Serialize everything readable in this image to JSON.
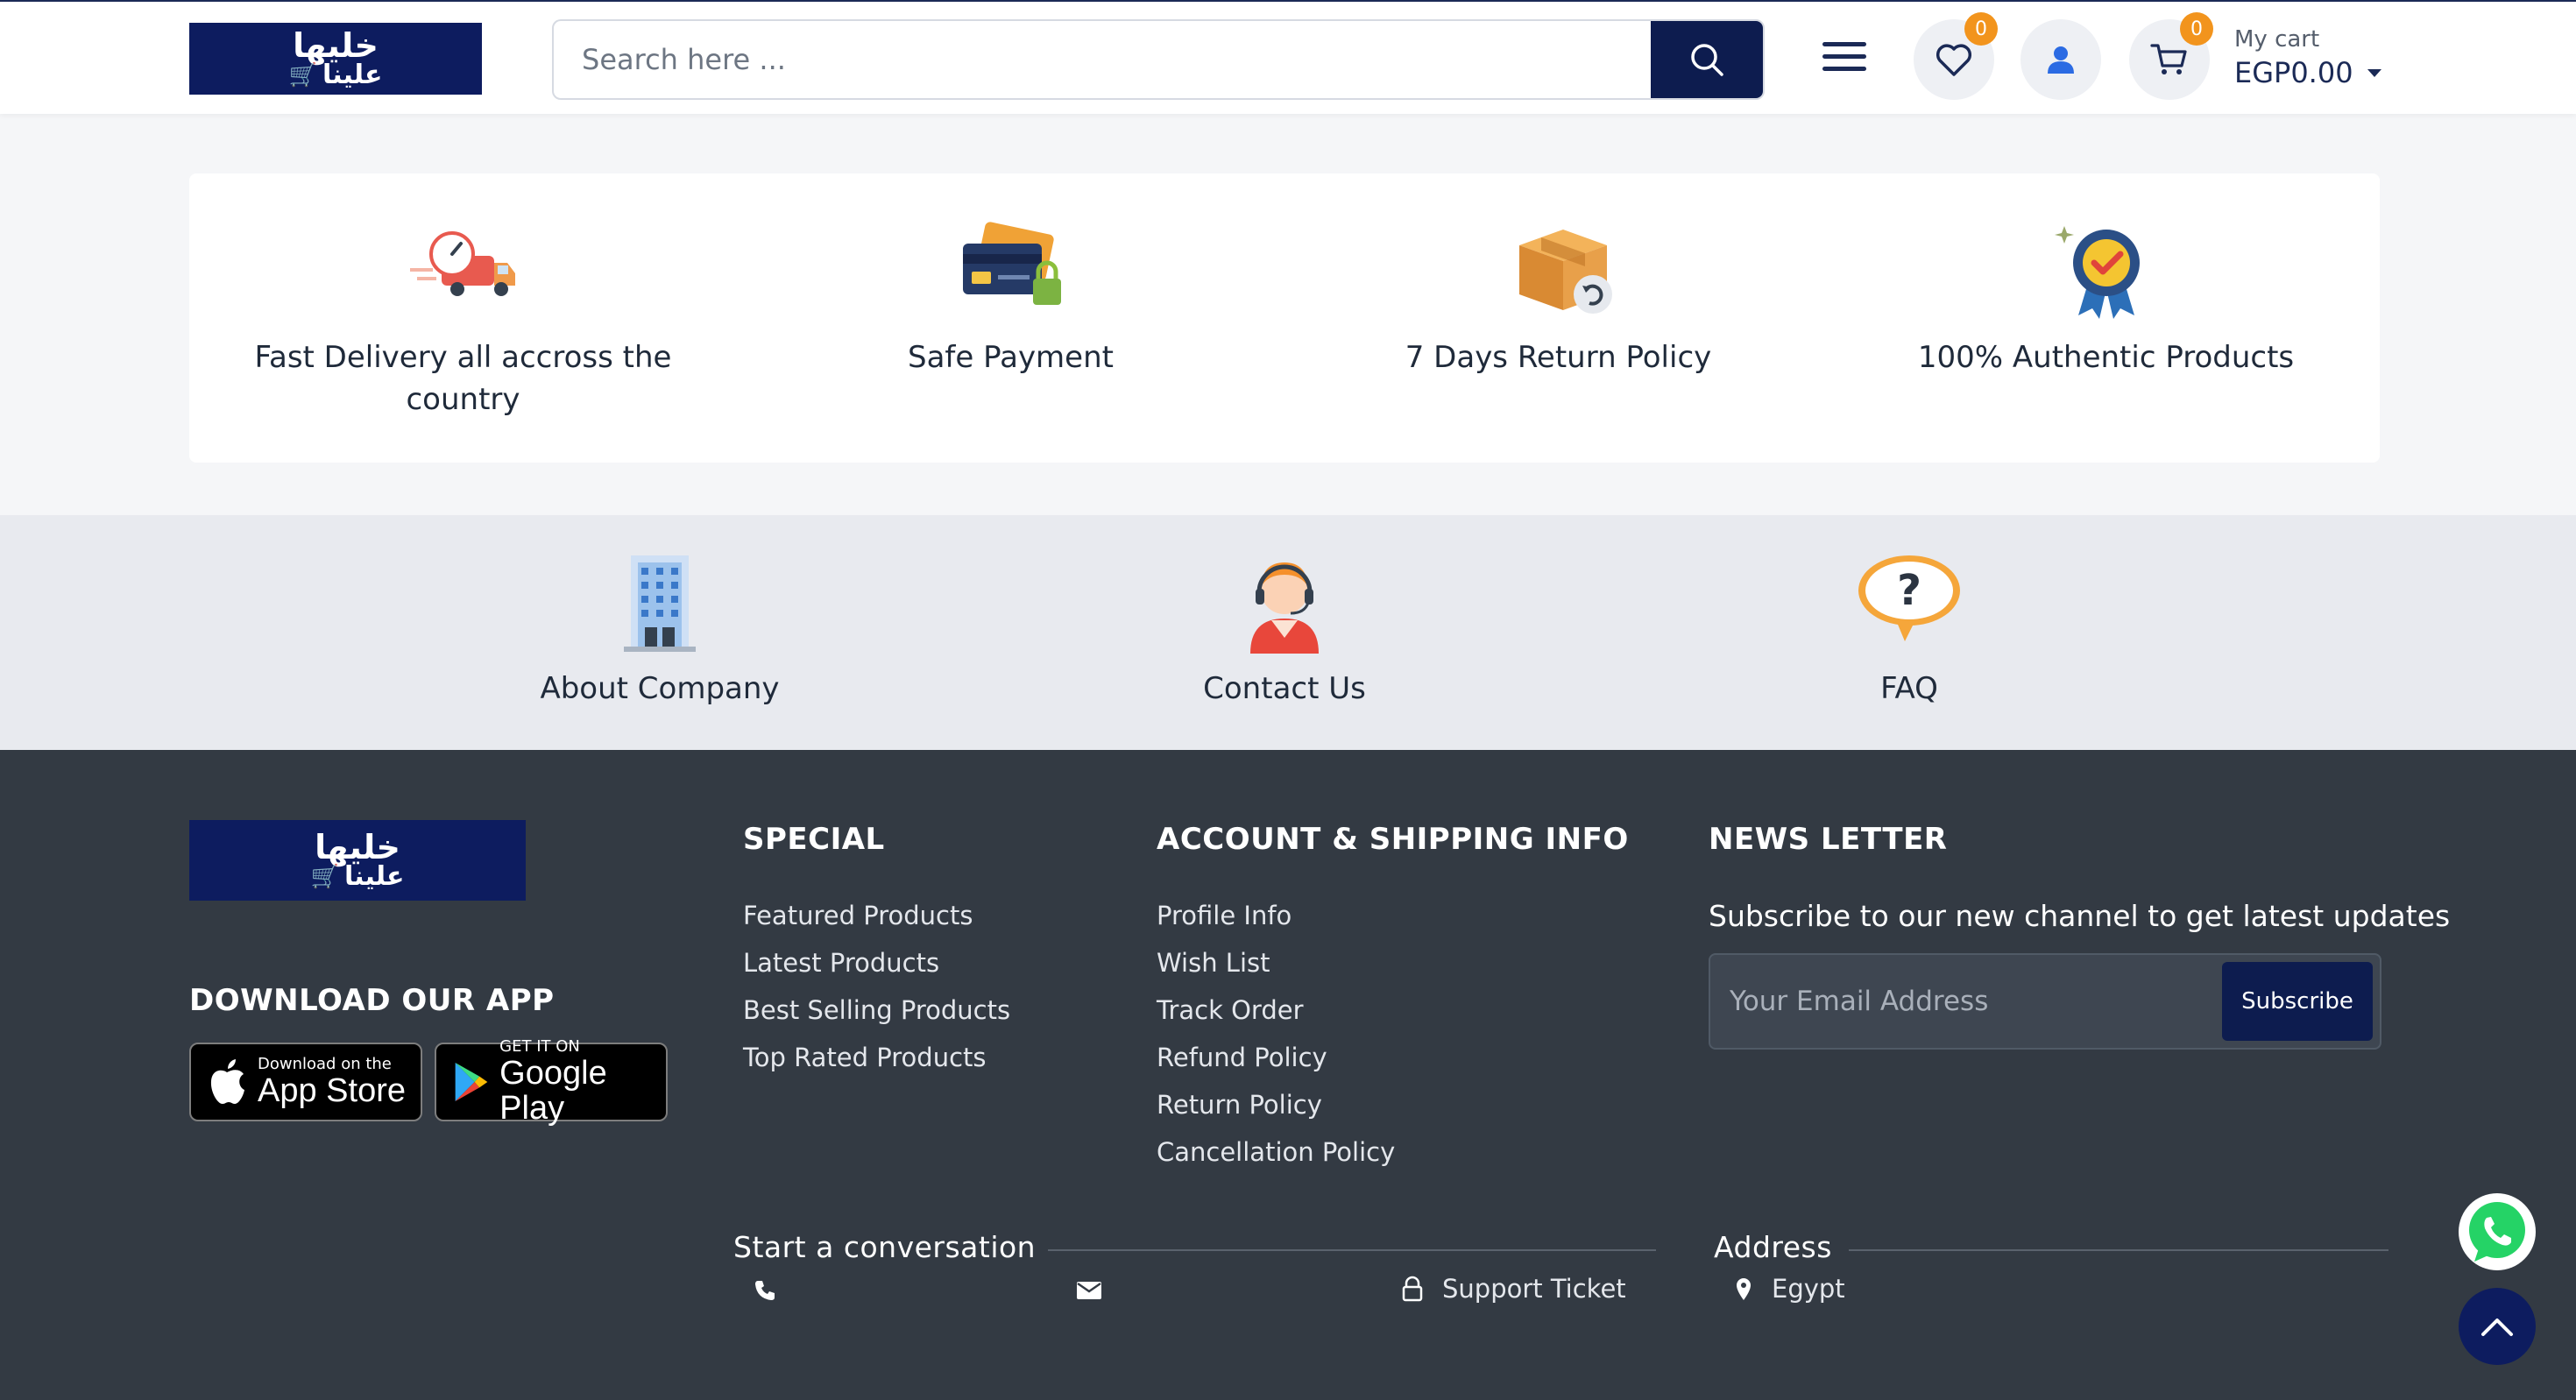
{
  "header": {
    "logo_line1": "خليها",
    "logo_line2": "علينا",
    "search_placeholder": "Search here ...",
    "wishlist_count": "0",
    "cart_count": "0",
    "cart_label": "My cart",
    "cart_total": "EGP0.00"
  },
  "features": [
    {
      "icon": "delivery-truck-icon",
      "label": "Fast Delivery all accross the country"
    },
    {
      "icon": "credit-card-lock-icon",
      "label": "Safe Payment"
    },
    {
      "icon": "return-box-icon",
      "label": "7 Days Return Policy"
    },
    {
      "icon": "authentic-badge-icon",
      "label": "100% Authentic Products"
    }
  ],
  "info_links": [
    {
      "icon": "company-building-icon",
      "label": "About Company"
    },
    {
      "icon": "support-agent-icon",
      "label": "Contact Us"
    },
    {
      "icon": "faq-bubble-icon",
      "label": "FAQ"
    }
  ],
  "footer": {
    "logo_line1": "خليها",
    "logo_line2": "علينا",
    "download_heading": "DOWNLOAD OUR APP",
    "app_store": {
      "small": "Download on the",
      "big": "App Store"
    },
    "google_play": {
      "small": "GET IT ON",
      "big": "Google Play"
    },
    "special_heading": "SPECIAL",
    "special_links": [
      "Featured Products",
      "Latest Products",
      "Best Selling Products",
      "Top Rated Products"
    ],
    "account_heading": "ACCOUNT & SHIPPING INFO",
    "account_links": [
      "Profile Info",
      "Wish List",
      "Track Order",
      "Refund Policy",
      "Return Policy",
      "Cancellation Policy"
    ],
    "newsletter_heading": "NEWS LETTER",
    "newsletter_text": "Subscribe to our new channel to get latest updates",
    "email_placeholder": "Your Email Address",
    "subscribe_label": "Subscribe",
    "conversation_heading": "Start a conversation",
    "support_ticket": "Support Ticket",
    "address_heading": "Address",
    "address_value": "Egypt"
  },
  "colors": {
    "brand_navy": "#0d1c4f",
    "badge_orange": "#f2941d",
    "footer_bg": "#333a43",
    "whatsapp_green": "#25d366"
  }
}
